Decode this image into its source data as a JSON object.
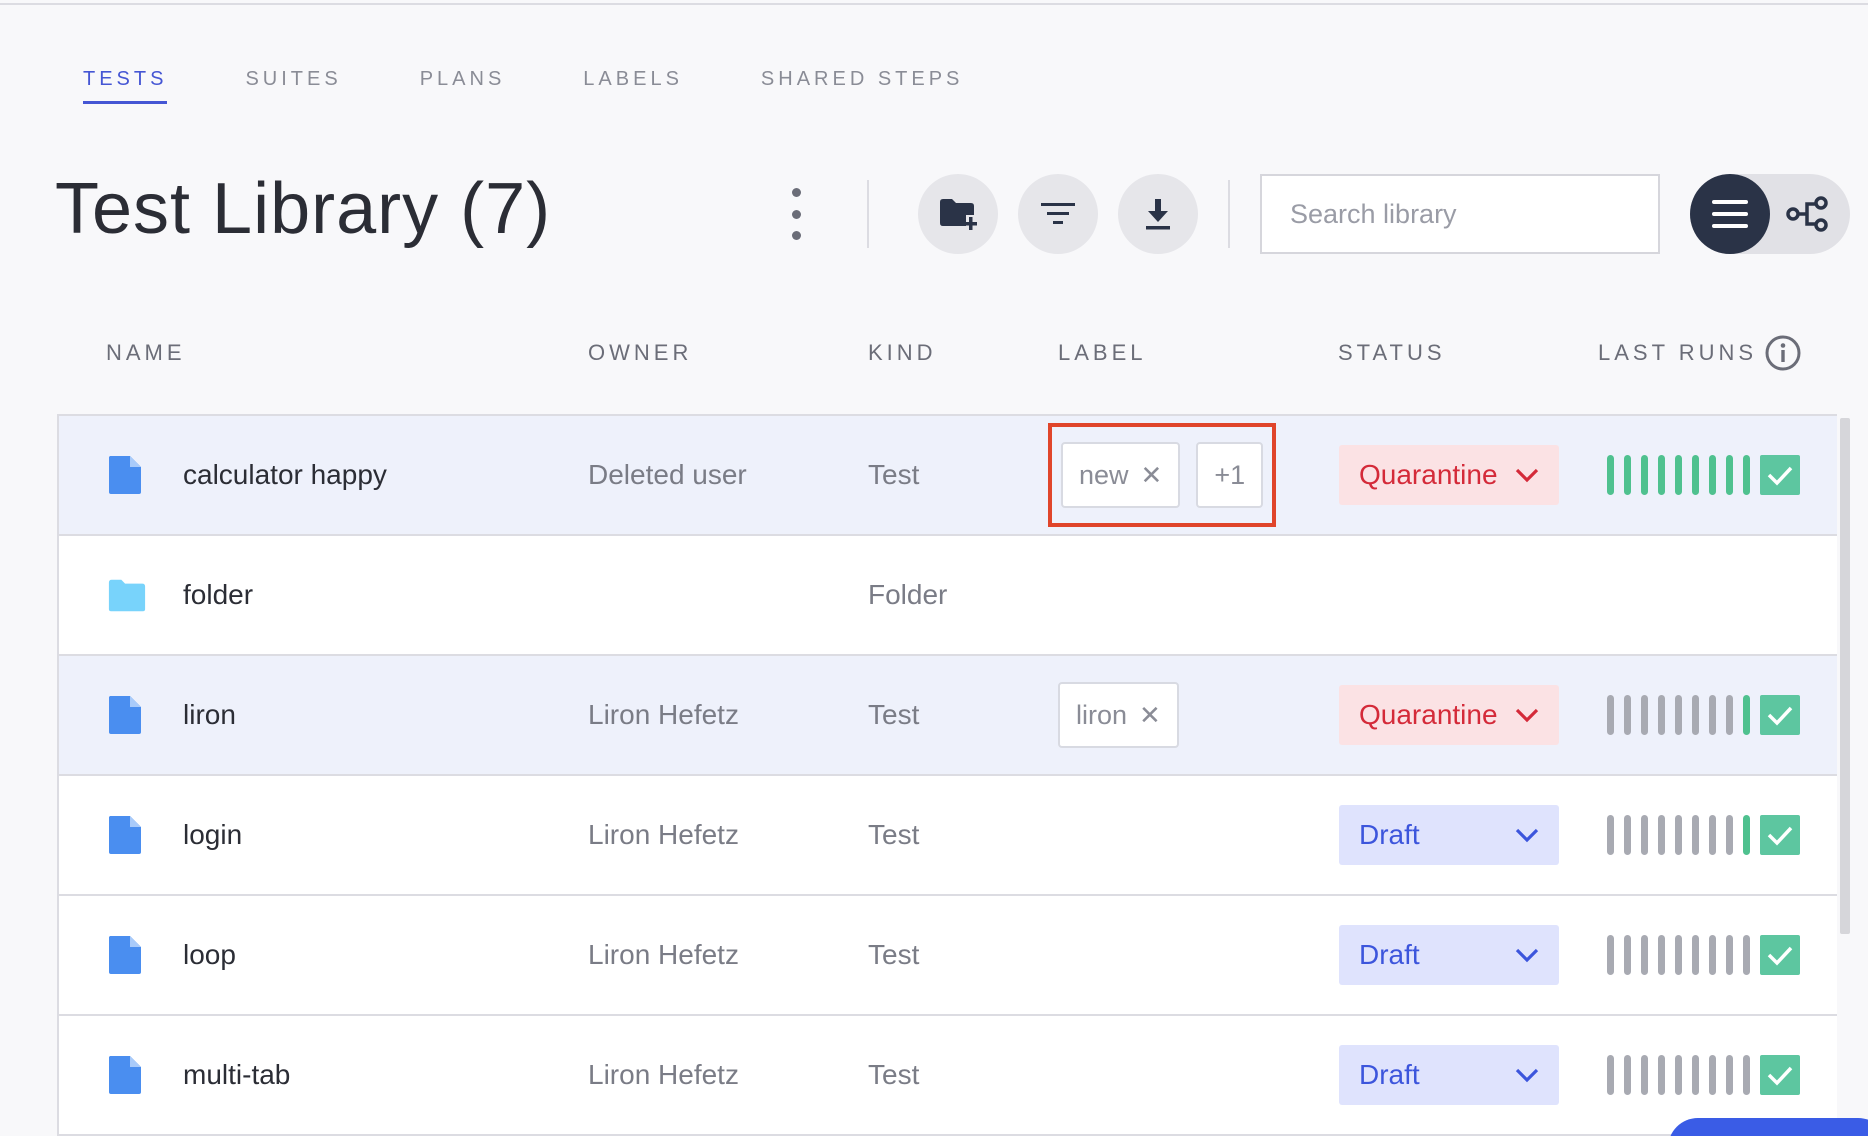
{
  "tabs": [
    {
      "label": "TESTS",
      "active": true
    },
    {
      "label": "SUITES",
      "active": false
    },
    {
      "label": "PLANS",
      "active": false
    },
    {
      "label": "LABELS",
      "active": false
    },
    {
      "label": "SHARED STEPS",
      "active": false
    }
  ],
  "header": {
    "title": "Test Library (7)",
    "search_placeholder": "Search library"
  },
  "columns": {
    "name": "NAME",
    "owner": "OWNER",
    "kind": "KIND",
    "label": "LABEL",
    "status": "STATUS",
    "last_runs": "LAST RUNS"
  },
  "rows": [
    {
      "icon": "file-icon",
      "name": "calculator happy",
      "owner": "Deleted user",
      "kind": "Test",
      "labels": [
        "new"
      ],
      "extra_labels": "+1",
      "status": "Quarantine",
      "runs": [
        "pass",
        "pass",
        "pass",
        "pass",
        "pass",
        "pass",
        "pass",
        "pass",
        "pass"
      ]
    },
    {
      "icon": "folder-icon",
      "name": "folder",
      "owner": "",
      "kind": "Folder",
      "labels": [],
      "extra_labels": "",
      "status": "",
      "runs": []
    },
    {
      "icon": "file-icon",
      "name": "liron",
      "owner": "Liron Hefetz",
      "kind": "Test",
      "labels": [
        "liron"
      ],
      "extra_labels": "",
      "status": "Quarantine",
      "runs": [
        "none",
        "none",
        "none",
        "none",
        "none",
        "none",
        "none",
        "none",
        "pass"
      ]
    },
    {
      "icon": "file-icon",
      "name": "login",
      "owner": "Liron Hefetz",
      "kind": "Test",
      "labels": [],
      "extra_labels": "",
      "status": "Draft",
      "runs": [
        "none",
        "none",
        "none",
        "none",
        "none",
        "none",
        "none",
        "none",
        "pass"
      ]
    },
    {
      "icon": "file-icon",
      "name": "loop",
      "owner": "Liron Hefetz",
      "kind": "Test",
      "labels": [],
      "extra_labels": "",
      "status": "Draft",
      "runs": [
        "none",
        "none",
        "none",
        "none",
        "none",
        "none",
        "none",
        "none",
        "none"
      ]
    },
    {
      "icon": "file-icon",
      "name": "multi-tab",
      "owner": "Liron Hefetz",
      "kind": "Test",
      "labels": [],
      "extra_labels": "",
      "status": "Draft",
      "runs": [
        "none",
        "none",
        "none",
        "none",
        "none",
        "none",
        "none",
        "none",
        "none"
      ]
    }
  ],
  "colors": {
    "accent": "#4556d4",
    "quarantine_bg": "#fbe2e4",
    "quarantine_text": "#d42a39",
    "draft_bg": "#dfe3fd",
    "draft_text": "#3c55dc",
    "run_pass": "#4fc18f",
    "run_none": "#a8aab2",
    "highlight_outline": "#e0452b"
  }
}
